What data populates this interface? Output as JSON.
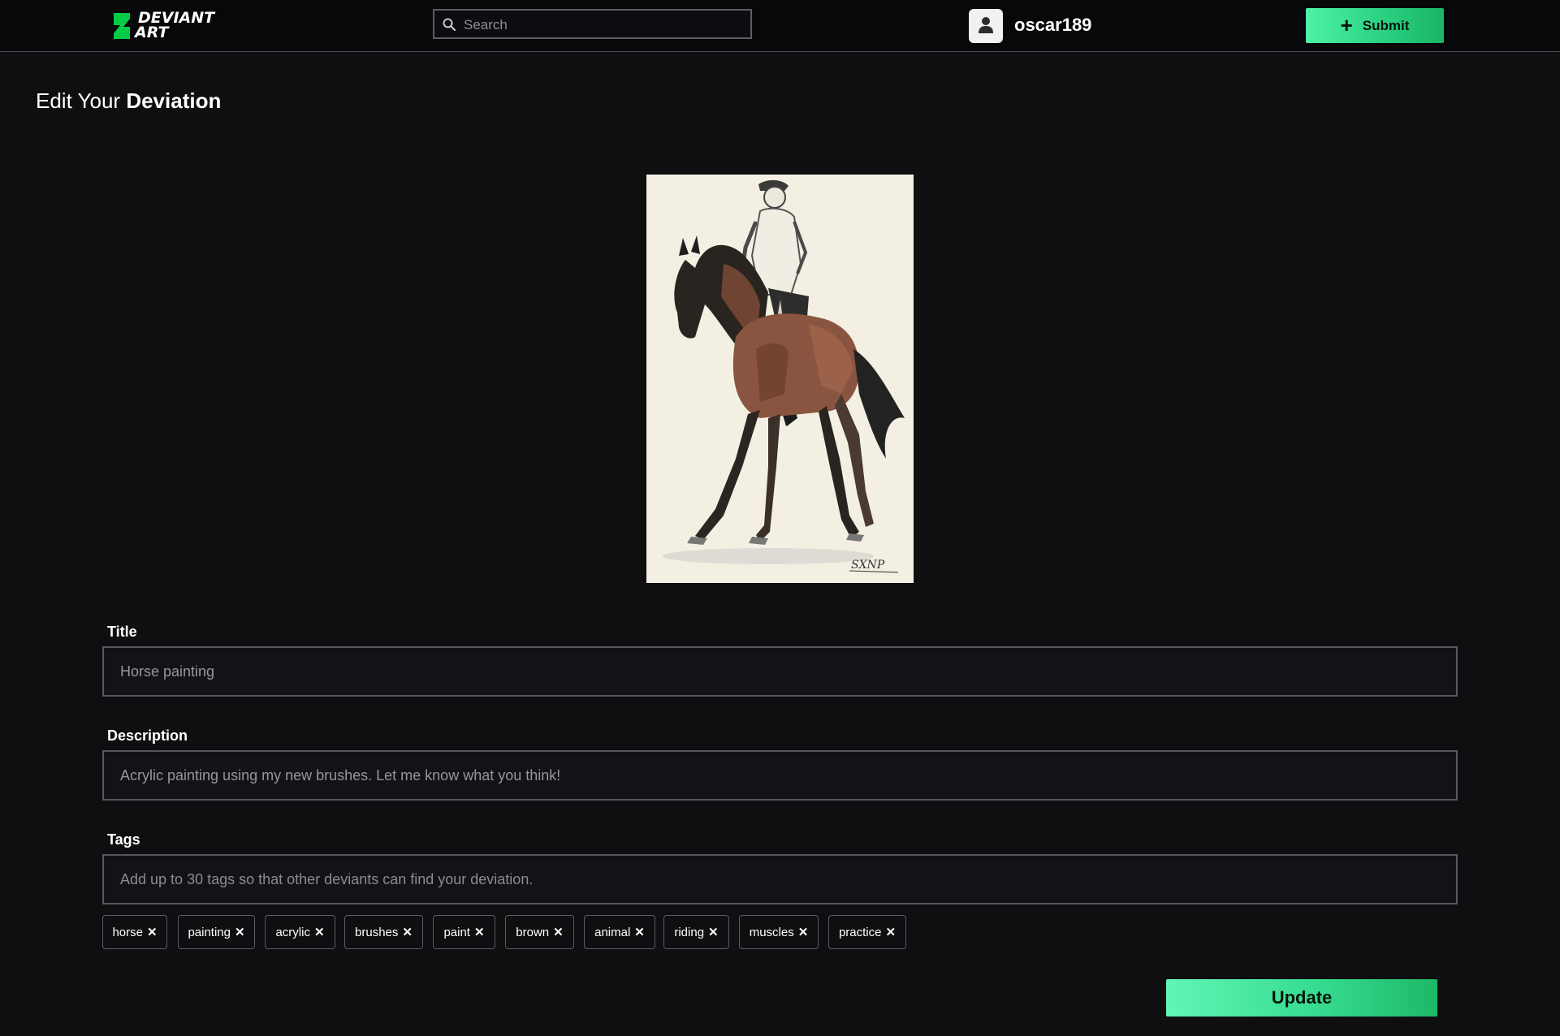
{
  "header": {
    "logo_line1": "DEVIANT",
    "logo_line2": "ART",
    "search_placeholder": "Search",
    "username": "oscar189",
    "submit_label": "Submit",
    "submit_plus": "+"
  },
  "page": {
    "title_prefix": "Edit Your ",
    "title_bold": "Deviation"
  },
  "artwork": {
    "description": "watercolor sketch of a horse and rider",
    "signature": "SXNP"
  },
  "form": {
    "title_label": "Title",
    "title_value": "Horse painting",
    "description_label": "Description",
    "description_value": "Acrylic painting using my new brushes. Let me know what you think!",
    "tags_label": "Tags",
    "tags_placeholder": "Add up to 30 tags so that other deviants can find your deviation.",
    "tags": [
      "horse",
      "painting",
      "acrylic",
      "brushes",
      "paint",
      "brown",
      "animal",
      "riding",
      "muscles",
      "practice"
    ],
    "tag_remove_glyph": "✕",
    "update_label": "Update"
  },
  "colors": {
    "accent": "#2ad283",
    "background": "#0f0f12",
    "topbar": "#07080a",
    "logo_green": "#05cc47"
  },
  "icons": [
    "deviantart-logo-icon",
    "search-icon",
    "user-icon",
    "plus-icon",
    "close-icon"
  ]
}
